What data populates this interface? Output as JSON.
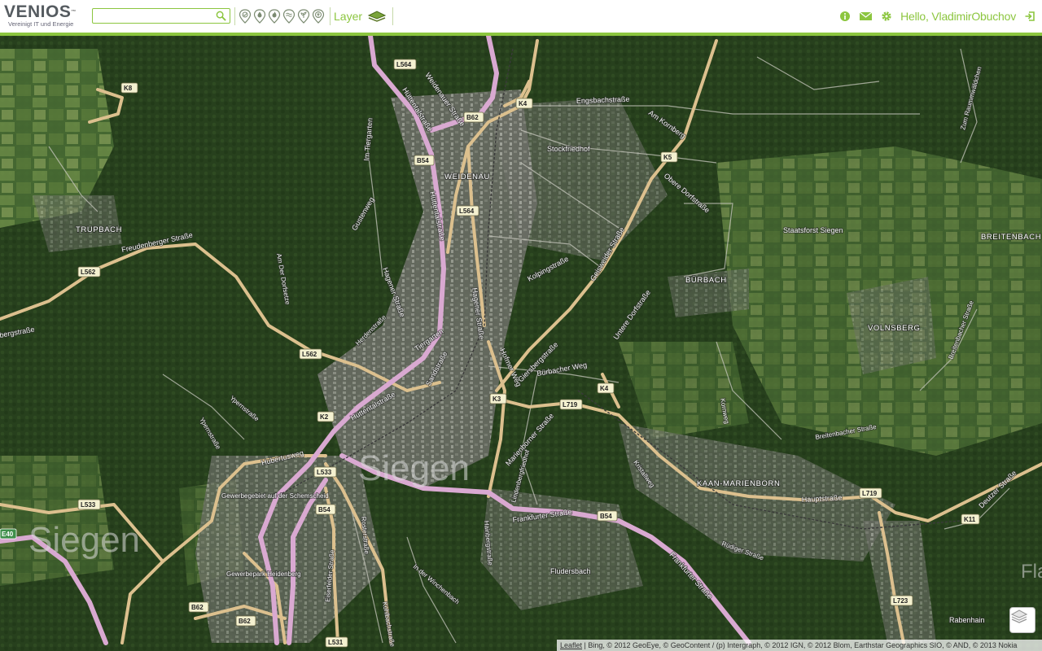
{
  "header": {
    "logo_word": "VENIOS",
    "logo_tm": "™",
    "logo_tagline": "Vereinigt IT und Energie",
    "search_placeholder": "",
    "filter_icons": [
      "location-pin-icon",
      "water-drop-icon",
      "flame-icon",
      "waves-icon",
      "plant-icon",
      "leaf-badge-icon"
    ],
    "layer_label": "Layer",
    "tools": [
      "info-icon",
      "mail-icon",
      "gear-icon"
    ],
    "greeting": "Hello, VladimirObuchov",
    "logout_icon": "logout-icon",
    "accent_color": "#8cc63f"
  },
  "map": {
    "towns": [
      "TRUPBACH",
      "WEIDENAU",
      "BÜRBACH",
      "BREITENBACH",
      "VOLNSBERG",
      "KAAN-MARIENBORN"
    ],
    "city_labels": [
      "Siegen",
      "Siegen",
      "Fla"
    ],
    "places": [
      "Staatsforst Siegen",
      "Stockfriedhof",
      "Gewerbegebiet auf der Schemscheid",
      "Gewerbepark Heidenberg",
      "Fludersbach",
      "Rabenhain"
    ],
    "streets": [
      "Freudenberger Straße",
      "bergstraße",
      "Hüttentalstraße",
      "Hüttentalstraße",
      "Hüttentalstraße",
      "Weidenauer Straße",
      "Engsbachstraße",
      "Am Kornberg",
      "Obere Dorfstraße",
      "Im Tiergarten",
      "Gustenweg",
      "Kolpingstraße",
      "Geisweider Straße",
      "Tiergarten",
      "Hagener Straße",
      "Hagener Straße",
      "Sandstraße",
      "Hofmer Weg",
      "Giersbergstraße",
      "Bürbacher Weg",
      "Marienborner Straße",
      "Untere Dorfstraße",
      "Frankfurter Straße",
      "Frankfurter Straße",
      "Hubertusweg",
      "Hauptstraße",
      "Breitenbacher Straße",
      "Breitenbacher Straße",
      "Deutzer Straße",
      "Kohlbachstraße",
      "Herdenstraße",
      "Rosterstraße",
      "Eiserfelder Straße",
      "In der Winchenbach",
      "Hainbergstraße",
      "Lindenbergfriedhof",
      "Rüdiger Straße",
      "Zum Raummwäldchen",
      "Ypernstraße",
      "Ypernstraße",
      "Kornweg",
      "Am Der Dorfsetze",
      "Kristallweg"
    ],
    "road_shields": [
      "K8",
      "L564",
      "L564",
      "B62",
      "K4",
      "B54",
      "K5",
      "L562",
      "L562",
      "K2",
      "K3",
      "L719",
      "K4",
      "L533",
      "L533",
      "B54",
      "B54",
      "L719",
      "K11",
      "B62",
      "B62",
      "L531",
      "L723",
      "E40"
    ],
    "attribution_link": "Leaflet",
    "attribution_text": " | Bing, © 2012 GeoEye, © GeoContent / (p) Intergraph, © 2012 IGN, © 2012 Blom, Earthstar Geographics SIO, © AND, © 2013 Nokia",
    "layer_toggle_icon": "layers-icon"
  }
}
